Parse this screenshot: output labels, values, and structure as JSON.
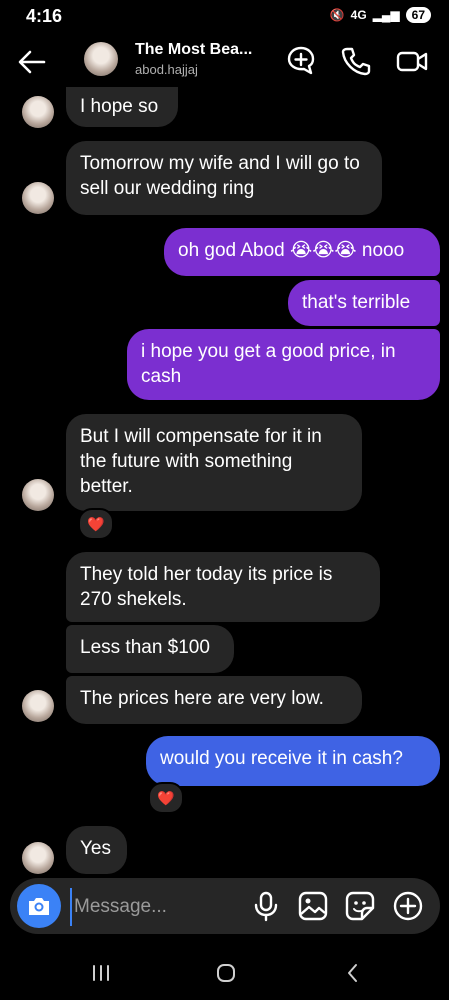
{
  "status": {
    "time": "4:16",
    "network": "4G",
    "battery": "67"
  },
  "header": {
    "title": "The Most Bea...",
    "username": "abod.hajjaj"
  },
  "messages": [
    {
      "text": "I hope so"
    },
    {
      "text": "Tomorrow my wife and I will go to sell our wedding ring"
    },
    {
      "text": "oh god Abod 😭😭😭 nooo"
    },
    {
      "text": "that's terrible"
    },
    {
      "text": "i hope you get a good price, in cash"
    },
    {
      "text": "But I will compensate for it in the future with something better.",
      "reaction": "❤️"
    },
    {
      "text": "They told her today its price is 270 shekels."
    },
    {
      "text": "Less than $100"
    },
    {
      "text": "The prices here are very low."
    },
    {
      "text": "would you receive it in cash?",
      "reaction": "❤️"
    },
    {
      "text": "Yes"
    }
  ],
  "composer": {
    "placeholder": "Message..."
  },
  "icons": {
    "back": "arrow-left-icon",
    "add_people": "add-people-icon",
    "call": "phone-icon",
    "video": "video-icon",
    "camera": "camera-icon",
    "mic": "microphone-icon",
    "gallery": "image-icon",
    "sticker": "sticker-icon",
    "plus": "plus-icon"
  },
  "colors": {
    "outgoing_purple": "#7b2fd0",
    "outgoing_blue": "#3f63e4",
    "incoming": "#262626",
    "camera": "#3b82f6"
  }
}
